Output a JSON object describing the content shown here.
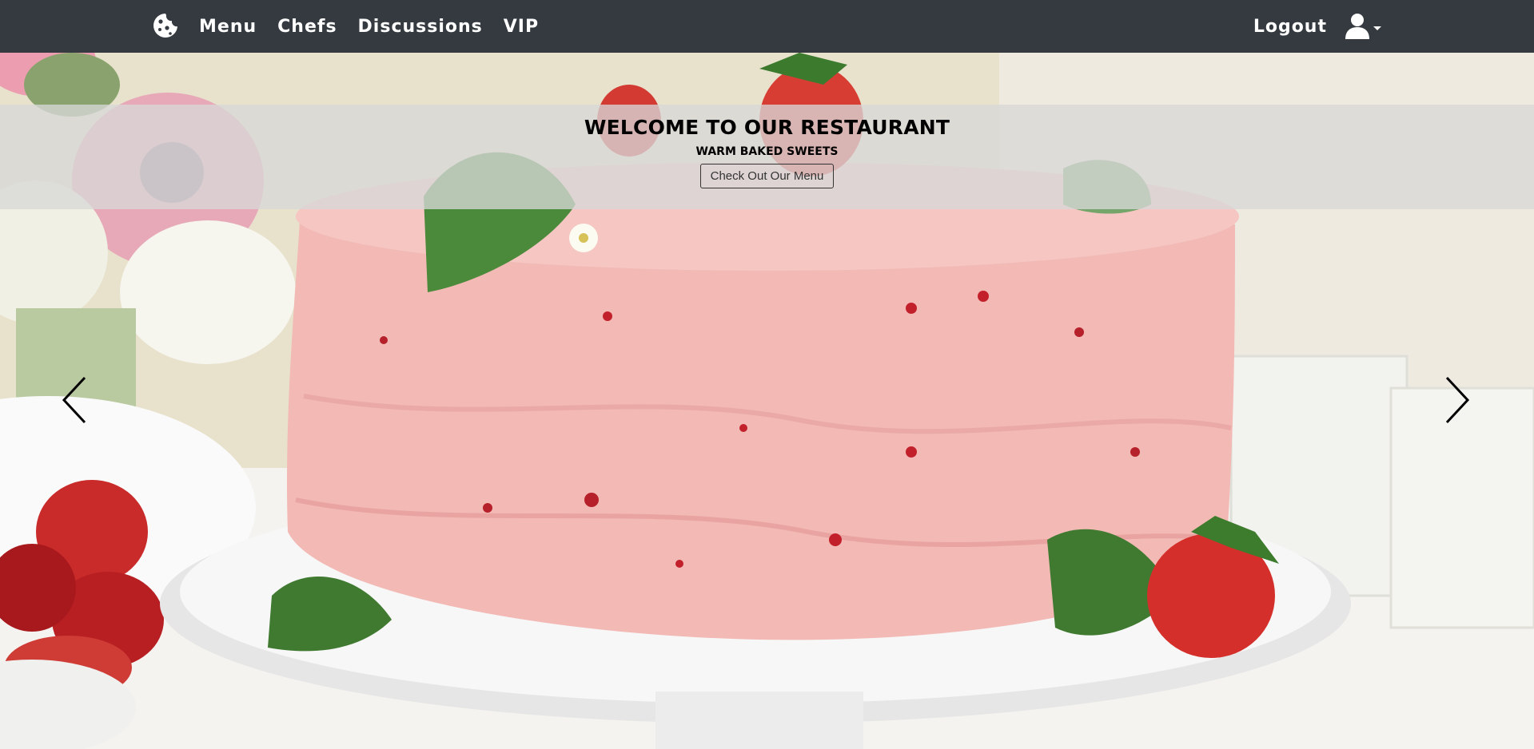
{
  "navbar": {
    "brand_icon": "cookie-icon",
    "links": [
      {
        "label": "Menu"
      },
      {
        "label": "Chefs"
      },
      {
        "label": "Discussions"
      },
      {
        "label": "VIP"
      }
    ],
    "logout_label": "Logout",
    "user_icon": "user-icon",
    "dropdown_icon": "caret-down-icon",
    "background_color": "#343a40",
    "text_color": "#ffffff"
  },
  "hero": {
    "title": "WELCOME TO OUR RESTAURANT",
    "subtitle": "WARM BAKED SWEETS",
    "button_label": "Check Out Our Menu",
    "prev_icon": "chevron-left-icon",
    "next_icon": "chevron-right-icon",
    "image_subject": "strawberry-cake-image",
    "overlay_color": "#d7d7d7"
  }
}
